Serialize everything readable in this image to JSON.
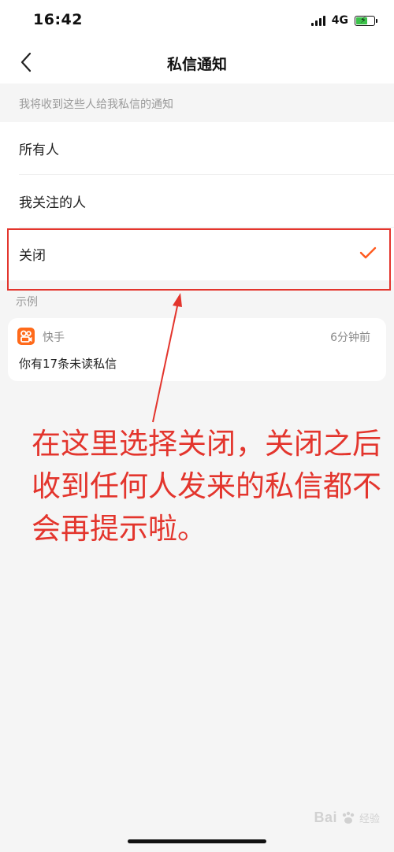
{
  "status_bar": {
    "time": "16:42",
    "network": "4G"
  },
  "nav": {
    "title": "私信通知",
    "back_icon": "chevron-left-icon"
  },
  "section_hint": "我将收到这些人给我私信的通知",
  "options": [
    {
      "label": "所有人",
      "selected": false
    },
    {
      "label": "我关注的人",
      "selected": false
    },
    {
      "label": "关闭",
      "selected": true
    }
  ],
  "example": {
    "label": "示例",
    "app_name": "快手",
    "time": "6分钟前",
    "message": "你有17条未读私信"
  },
  "annotation": {
    "text": "在这里选择关闭，关闭之后收到任何人发来的私信都不会再提示啦。",
    "color": "#e3352d"
  },
  "watermark": {
    "brand": "Bai",
    "suffix": "经验"
  },
  "colors": {
    "accent": "#ff5a1f",
    "highlight": "#e3352d",
    "battery": "#3cc24a"
  }
}
